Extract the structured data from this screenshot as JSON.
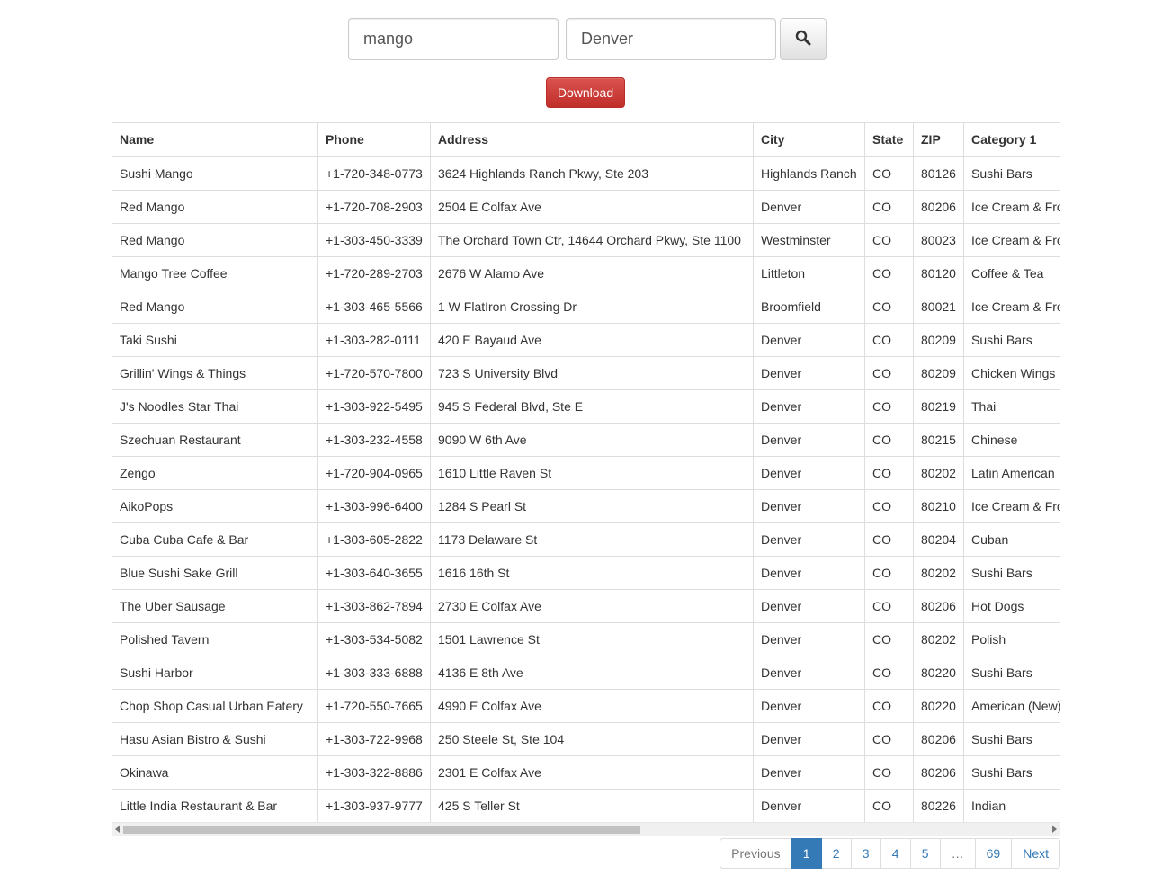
{
  "search": {
    "query_value": "mango",
    "location_value": "Denver",
    "button_icon": "search-icon"
  },
  "download": {
    "label": "Download",
    "color": "#d9534f"
  },
  "table": {
    "columns": [
      "Name",
      "Phone",
      "Address",
      "City",
      "State",
      "ZIP",
      "Category 1"
    ],
    "rows": [
      [
        "Sushi Mango",
        "+1-720-348-0773",
        "3624 Highlands Ranch Pkwy, Ste 203",
        "Highlands Ranch",
        "CO",
        "80126",
        "Sushi Bars"
      ],
      [
        "Red Mango",
        "+1-720-708-2903",
        "2504 E Colfax Ave",
        "Denver",
        "CO",
        "80206",
        "Ice Cream & Fro"
      ],
      [
        "Red Mango",
        "+1-303-450-3339",
        "The Orchard Town Ctr, 14644 Orchard Pkwy, Ste 1100",
        "Westminster",
        "CO",
        "80023",
        "Ice Cream & Fro"
      ],
      [
        "Mango Tree Coffee",
        "+1-720-289-2703",
        "2676 W Alamo Ave",
        "Littleton",
        "CO",
        "80120",
        "Coffee & Tea"
      ],
      [
        "Red Mango",
        "+1-303-465-5566",
        "1 W FlatIron Crossing Dr",
        "Broomfield",
        "CO",
        "80021",
        "Ice Cream & Fro"
      ],
      [
        "Taki Sushi",
        "+1-303-282-0111",
        "420 E Bayaud Ave",
        "Denver",
        "CO",
        "80209",
        "Sushi Bars"
      ],
      [
        "Grillin' Wings & Things",
        "+1-720-570-7800",
        "723 S University Blvd",
        "Denver",
        "CO",
        "80209",
        "Chicken Wings"
      ],
      [
        "J's Noodles Star Thai",
        "+1-303-922-5495",
        "945 S Federal Blvd, Ste E",
        "Denver",
        "CO",
        "80219",
        "Thai"
      ],
      [
        "Szechuan Restaurant",
        "+1-303-232-4558",
        "9090 W 6th Ave",
        "Denver",
        "CO",
        "80215",
        "Chinese"
      ],
      [
        "Zengo",
        "+1-720-904-0965",
        "1610 Little Raven St",
        "Denver",
        "CO",
        "80202",
        "Latin American"
      ],
      [
        "AikoPops",
        "+1-303-996-6400",
        "1284 S Pearl St",
        "Denver",
        "CO",
        "80210",
        "Ice Cream & Fro"
      ],
      [
        "Cuba Cuba Cafe & Bar",
        "+1-303-605-2822",
        "1173 Delaware St",
        "Denver",
        "CO",
        "80204",
        "Cuban"
      ],
      [
        "Blue Sushi Sake Grill",
        "+1-303-640-3655",
        "1616 16th St",
        "Denver",
        "CO",
        "80202",
        "Sushi Bars"
      ],
      [
        "The Uber Sausage",
        "+1-303-862-7894",
        "2730 E Colfax Ave",
        "Denver",
        "CO",
        "80206",
        "Hot Dogs"
      ],
      [
        "Polished Tavern",
        "+1-303-534-5082",
        "1501 Lawrence St",
        "Denver",
        "CO",
        "80202",
        "Polish"
      ],
      [
        "Sushi Harbor",
        "+1-303-333-6888",
        "4136 E 8th Ave",
        "Denver",
        "CO",
        "80220",
        "Sushi Bars"
      ],
      [
        "Chop Shop Casual Urban Eatery",
        "+1-720-550-7665",
        "4990 E Colfax Ave",
        "Denver",
        "CO",
        "80220",
        "American (New)"
      ],
      [
        "Hasu Asian Bistro & Sushi",
        "+1-303-722-9968",
        "250 Steele St, Ste 104",
        "Denver",
        "CO",
        "80206",
        "Sushi Bars"
      ],
      [
        "Okinawa",
        "+1-303-322-8886",
        "2301 E Colfax Ave",
        "Denver",
        "CO",
        "80206",
        "Sushi Bars"
      ],
      [
        "Little India Restaurant & Bar",
        "+1-303-937-9777",
        "425 S Teller St",
        "Denver",
        "CO",
        "80226",
        "Indian"
      ]
    ]
  },
  "pagination": {
    "previous": "Previous",
    "pages": [
      "1",
      "2",
      "3",
      "4",
      "5"
    ],
    "ellipsis": "…",
    "last_page": "69",
    "next": "Next",
    "active_page": "1",
    "accent_color": "#337ab7"
  }
}
